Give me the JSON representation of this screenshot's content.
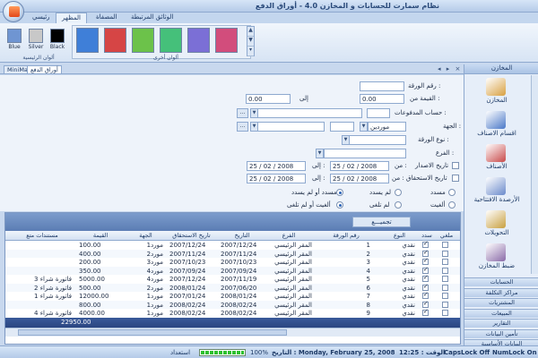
{
  "window": {
    "title": "نظام سمارت للحسابات و المخازن 4.0 - أوراق الدفع"
  },
  "ribbon": {
    "tabs": [
      "رئيسي",
      "المظهر",
      "المصفاة",
      "الوثائق المرتبطة"
    ],
    "active_tab": "المظهر",
    "main_colors_label": "ألوان الرئيسية",
    "other_colors_label": "ألوان أخرى",
    "main_colors": [
      {
        "label": "Black",
        "color": "#000000"
      },
      {
        "label": "Silver",
        "color": "#c8c8c8"
      },
      {
        "label": "Blue",
        "color": "#6f95d2"
      }
    ],
    "other_colors": [
      "#3f7fd8",
      "#d64545",
      "#6cc24a",
      "#45c07a",
      "#7b6fd6",
      "#d24d7c"
    ]
  },
  "doc_tabs": {
    "active": "أوراق الدفع",
    "other": "MiniMax",
    "controls": "◂ ▸ ×"
  },
  "form": {
    "paper_no_label": "رقم الورقة :",
    "value_from_label": "القيمة من :",
    "value_to_label": "إلى",
    "value_from": "0.00",
    "value_to": "0.00",
    "payments_account_label": "حساب المدفوعات :",
    "party_label": "الجهة :",
    "party_type": "موردين",
    "paper_type_label": "نوع الورقة :",
    "branch_label": "الفرع :",
    "issue_date_label": "تاريخ الاصدار",
    "due_date_label": "تاريخ الاستحقاق",
    "from_label": "من :",
    "to_label": "إلى :",
    "dates": [
      "25 / 02 / 2008",
      "25 / 02 / 2008",
      "25 / 02 / 2008",
      "25 / 02 / 2008"
    ],
    "radios_row1": [
      "مسدد",
      "لم يسدد",
      "مسدد أو لم يسدد"
    ],
    "radios_row2": [
      "ألغيت",
      "لم تلغى",
      "ألغيت أو لم تلغى"
    ]
  },
  "grid": {
    "group_button": "تجميـــع",
    "columns": [
      "ملغي",
      "سدد",
      "النوع",
      "رقم الورقة",
      "الفرع",
      "التاريخ",
      "تاريخ الاستحقاق",
      "الجهة",
      "القيمة",
      "مستندات متع"
    ],
    "rows": [
      {
        "canceled": false,
        "paid": true,
        "type": "نقدي",
        "no": "1",
        "branch": "المقر الرئيسي",
        "date": "2007/12/24",
        "due": "2007/12/24",
        "party": "مورد1",
        "value": "100.00",
        "docs": ""
      },
      {
        "canceled": false,
        "paid": true,
        "type": "نقدي",
        "no": "2",
        "branch": "المقر الرئيسي",
        "date": "2007/11/24",
        "due": "2007/11/24",
        "party": "مورد2",
        "value": "400.00",
        "docs": ""
      },
      {
        "canceled": false,
        "paid": true,
        "type": "نقدي",
        "no": "3",
        "branch": "المقر الرئيسي",
        "date": "2007/10/23",
        "due": "2007/10/23",
        "party": "مورد3",
        "value": "200.00",
        "docs": ""
      },
      {
        "canceled": false,
        "paid": true,
        "type": "نقدي",
        "no": "4",
        "branch": "المقر الرئيسي",
        "date": "2007/09/24",
        "due": "2007/09/24",
        "party": "مورد4",
        "value": "350.00",
        "docs": ""
      },
      {
        "canceled": false,
        "paid": true,
        "type": "نقدي",
        "no": "5",
        "branch": "المقر الرئيسي",
        "date": "2007/11/19",
        "due": "2007/12/24",
        "party": "مورد4",
        "value": "5000.00",
        "docs": "فاتورة شراء 3"
      },
      {
        "canceled": false,
        "paid": true,
        "type": "نقدي",
        "no": "6",
        "branch": "المقر الرئيسي",
        "date": "2007/06/20",
        "due": "2008/01/24",
        "party": "مورد2",
        "value": "500.00",
        "docs": "فاتورة شراء 2"
      },
      {
        "canceled": false,
        "paid": true,
        "type": "نقدي",
        "no": "7",
        "branch": "المقر الرئيسي",
        "date": "2008/01/24",
        "due": "2007/01/24",
        "party": "مورد1",
        "value": "12000.00",
        "docs": "فاتورة شراء 1"
      },
      {
        "canceled": false,
        "paid": true,
        "type": "نقدي",
        "no": "8",
        "branch": "المقر الرئيسي",
        "date": "2008/02/24",
        "due": "2008/02/24",
        "party": "مورد1",
        "value": "800.00",
        "docs": ""
      },
      {
        "canceled": false,
        "paid": true,
        "type": "نقدي",
        "no": "9",
        "branch": "المقر الرئيسي",
        "date": "2008/02/24",
        "due": "2008/02/24",
        "party": "مورد1",
        "value": "4000.00",
        "docs": "فاتورة شراء 4"
      }
    ],
    "total": "22950.00"
  },
  "nav": {
    "header": "المخازن",
    "items": [
      {
        "label": "المخازن",
        "icon": "warehouse-box-icon",
        "color": "#d8a040"
      },
      {
        "label": "اقسام الاصناف",
        "icon": "item-categories-icon",
        "color": "#4a78c8"
      },
      {
        "label": "الأصناف",
        "icon": "items-shapes-icon",
        "color": "#c84a4a"
      },
      {
        "label": "الأرصدة الافتتاحية",
        "icon": "opening-balance-icon",
        "color": "#6a8acb"
      },
      {
        "label": "التحويلات",
        "icon": "transfers-icon",
        "color": "#c8a040"
      },
      {
        "label": "ضبط المخازن",
        "icon": "inventory-adjust-icon",
        "color": "#8a6aa8"
      }
    ],
    "sections": [
      "الحسابات",
      "مراكز التكلفة",
      "المشتريات",
      "المبيعات",
      "التقارير",
      "تأمين البيانات",
      "البيانات الأساسية"
    ]
  },
  "status": {
    "ready": "استعداد",
    "percent": "100%",
    "progress": 1.0,
    "date": "التاريخ : Monday, February 25, 2008",
    "time": "الوقت : 12:25",
    "caps": "CapsLock Off",
    "num": "NumLock On"
  }
}
